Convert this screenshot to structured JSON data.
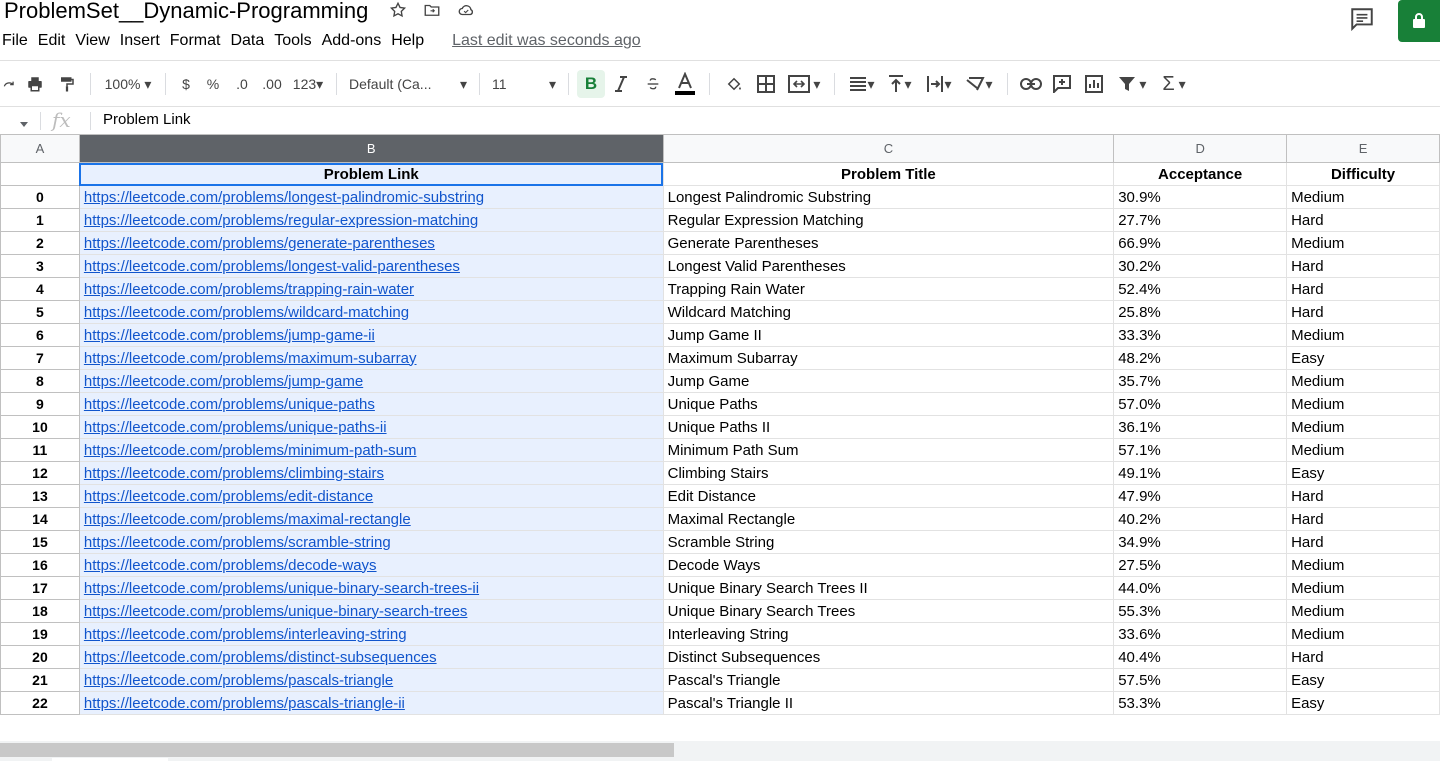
{
  "title": "ProblemSet__Dynamic-Programming",
  "menu": [
    "File",
    "Edit",
    "View",
    "Insert",
    "Format",
    "Data",
    "Tools",
    "Add-ons",
    "Help"
  ],
  "last_edit": "Last edit was seconds ago",
  "toolbar": {
    "zoom": "100%",
    "currency": "$",
    "percent": "%",
    "decrease_decimal": ".0",
    "increase_decimal": ".00",
    "more_formats": "123",
    "font": "Default (Ca...",
    "font_size": "11",
    "bold": "B"
  },
  "formula_bar": {
    "fx": "fx",
    "value": "Problem Link"
  },
  "columns": [
    "A",
    "B",
    "C",
    "D",
    "E"
  ],
  "header_row": {
    "b": "Problem Link",
    "c": "Problem Title",
    "d": "Acceptance",
    "e": "Difficulty"
  },
  "rows": [
    {
      "idx": "0",
      "link": "https://leetcode.com/problems/longest-palindromic-substring",
      "title": "Longest Palindromic Substring",
      "acc": "30.9%",
      "diff": "Medium"
    },
    {
      "idx": "1",
      "link": "https://leetcode.com/problems/regular-expression-matching",
      "title": "Regular Expression Matching",
      "acc": "27.7%",
      "diff": "Hard"
    },
    {
      "idx": "2",
      "link": "https://leetcode.com/problems/generate-parentheses",
      "title": "Generate Parentheses",
      "acc": "66.9%",
      "diff": "Medium"
    },
    {
      "idx": "3",
      "link": "https://leetcode.com/problems/longest-valid-parentheses",
      "title": "Longest Valid Parentheses",
      "acc": "30.2%",
      "diff": "Hard"
    },
    {
      "idx": "4",
      "link": "https://leetcode.com/problems/trapping-rain-water",
      "title": "Trapping Rain Water",
      "acc": "52.4%",
      "diff": "Hard"
    },
    {
      "idx": "5",
      "link": "https://leetcode.com/problems/wildcard-matching",
      "title": "Wildcard Matching",
      "acc": "25.8%",
      "diff": "Hard"
    },
    {
      "idx": "6",
      "link": "https://leetcode.com/problems/jump-game-ii",
      "title": "Jump Game II",
      "acc": "33.3%",
      "diff": "Medium"
    },
    {
      "idx": "7",
      "link": "https://leetcode.com/problems/maximum-subarray",
      "title": "Maximum Subarray",
      "acc": "48.2%",
      "diff": "Easy"
    },
    {
      "idx": "8",
      "link": "https://leetcode.com/problems/jump-game",
      "title": "Jump Game",
      "acc": "35.7%",
      "diff": "Medium"
    },
    {
      "idx": "9",
      "link": "https://leetcode.com/problems/unique-paths",
      "title": "Unique Paths",
      "acc": "57.0%",
      "diff": "Medium"
    },
    {
      "idx": "10",
      "link": "https://leetcode.com/problems/unique-paths-ii",
      "title": "Unique Paths II",
      "acc": "36.1%",
      "diff": "Medium"
    },
    {
      "idx": "11",
      "link": "https://leetcode.com/problems/minimum-path-sum",
      "title": "Minimum Path Sum",
      "acc": "57.1%",
      "diff": "Medium"
    },
    {
      "idx": "12",
      "link": "https://leetcode.com/problems/climbing-stairs",
      "title": "Climbing Stairs",
      "acc": "49.1%",
      "diff": "Easy"
    },
    {
      "idx": "13",
      "link": "https://leetcode.com/problems/edit-distance",
      "title": "Edit Distance",
      "acc": "47.9%",
      "diff": "Hard"
    },
    {
      "idx": "14",
      "link": "https://leetcode.com/problems/maximal-rectangle",
      "title": "Maximal Rectangle",
      "acc": "40.2%",
      "diff": "Hard"
    },
    {
      "idx": "15",
      "link": "https://leetcode.com/problems/scramble-string",
      "title": "Scramble String",
      "acc": "34.9%",
      "diff": "Hard"
    },
    {
      "idx": "16",
      "link": "https://leetcode.com/problems/decode-ways",
      "title": "Decode Ways",
      "acc": "27.5%",
      "diff": "Medium"
    },
    {
      "idx": "17",
      "link": "https://leetcode.com/problems/unique-binary-search-trees-ii",
      "title": "Unique Binary Search Trees II",
      "acc": "44.0%",
      "diff": "Medium"
    },
    {
      "idx": "18",
      "link": "https://leetcode.com/problems/unique-binary-search-trees",
      "title": "Unique Binary Search Trees",
      "acc": "55.3%",
      "diff": "Medium"
    },
    {
      "idx": "19",
      "link": "https://leetcode.com/problems/interleaving-string",
      "title": "Interleaving String",
      "acc": "33.6%",
      "diff": "Medium"
    },
    {
      "idx": "20",
      "link": "https://leetcode.com/problems/distinct-subsequences",
      "title": "Distinct Subsequences",
      "acc": "40.4%",
      "diff": "Hard"
    },
    {
      "idx": "21",
      "link": "https://leetcode.com/problems/pascals-triangle",
      "title": "Pascal's Triangle",
      "acc": "57.5%",
      "diff": "Easy"
    },
    {
      "idx": "22",
      "link": "https://leetcode.com/problems/pascals-triangle-ii",
      "title": "Pascal's Triangle II",
      "acc": "53.3%",
      "diff": "Easy"
    }
  ]
}
